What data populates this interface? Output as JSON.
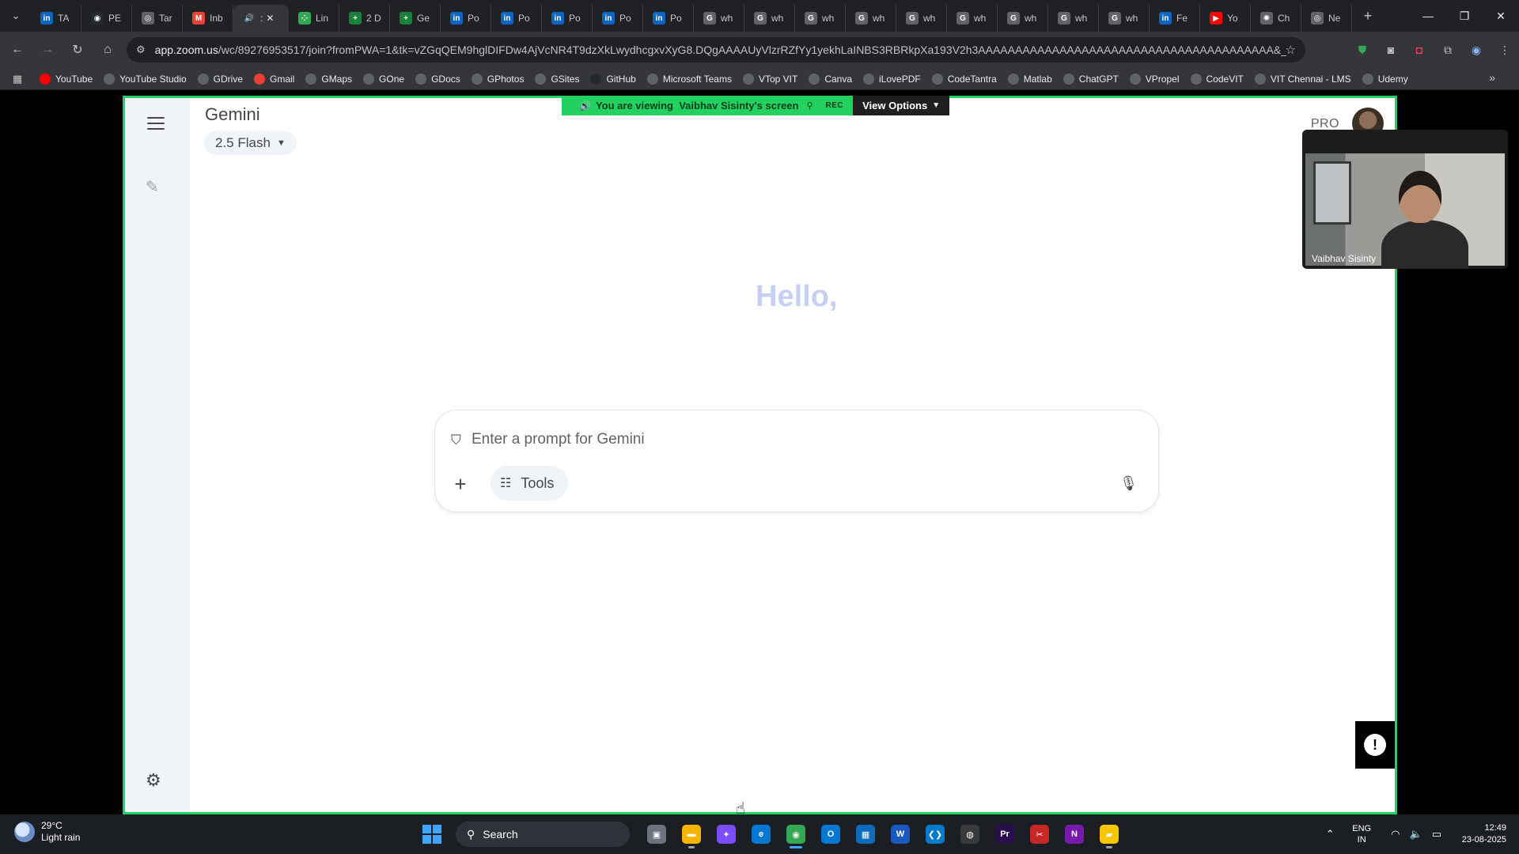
{
  "browser": {
    "tabs": [
      {
        "label": "TA",
        "icon": "linkedin-icon",
        "color": "#0a66c2",
        "glyph": "in"
      },
      {
        "label": "PE",
        "icon": "github-icon",
        "color": "#24292f",
        "glyph": "◉"
      },
      {
        "label": "Tar",
        "icon": "globe-icon",
        "color": "#5f6368",
        "glyph": "◎"
      },
      {
        "label": "Inb",
        "icon": "gmail-icon",
        "color": "#ea4335",
        "glyph": "M"
      },
      {
        "label": ":",
        "icon": "speaker-icon",
        "color": "#35363a",
        "glyph": "🔊",
        "active": true
      },
      {
        "label": "Lin",
        "icon": "dots-icon",
        "color": "#34a853",
        "glyph": "⁘"
      },
      {
        "label": "2 D",
        "icon": "sheets-icon",
        "color": "#188038",
        "glyph": "+"
      },
      {
        "label": "Ge",
        "icon": "sheets-icon",
        "color": "#188038",
        "glyph": "+"
      },
      {
        "label": "Po",
        "icon": "linkedin-icon",
        "color": "#0a66c2",
        "glyph": "in"
      },
      {
        "label": "Po",
        "icon": "linkedin-icon",
        "color": "#0a66c2",
        "glyph": "in"
      },
      {
        "label": "Po",
        "icon": "linkedin-icon",
        "color": "#0a66c2",
        "glyph": "in"
      },
      {
        "label": "Po",
        "icon": "linkedin-icon",
        "color": "#0a66c2",
        "glyph": "in"
      },
      {
        "label": "Po",
        "icon": "linkedin-icon",
        "color": "#0a66c2",
        "glyph": "in"
      },
      {
        "label": "wh",
        "icon": "google-icon",
        "color": "#5f6368",
        "glyph": "G"
      },
      {
        "label": "wh",
        "icon": "google-icon",
        "color": "#5f6368",
        "glyph": "G"
      },
      {
        "label": "wh",
        "icon": "google-icon",
        "color": "#5f6368",
        "glyph": "G"
      },
      {
        "label": "wh",
        "icon": "google-icon",
        "color": "#5f6368",
        "glyph": "G"
      },
      {
        "label": "wh",
        "icon": "google-icon",
        "color": "#5f6368",
        "glyph": "G"
      },
      {
        "label": "wh",
        "icon": "google-icon",
        "color": "#5f6368",
        "glyph": "G"
      },
      {
        "label": "wh",
        "icon": "google-icon",
        "color": "#5f6368",
        "glyph": "G"
      },
      {
        "label": "wh",
        "icon": "google-icon",
        "color": "#5f6368",
        "glyph": "G"
      },
      {
        "label": "wh",
        "icon": "google-icon",
        "color": "#5f6368",
        "glyph": "G"
      },
      {
        "label": "Fe",
        "icon": "linkedin-icon",
        "color": "#0a66c2",
        "glyph": "in"
      },
      {
        "label": "Yo",
        "icon": "youtube-icon",
        "color": "#ff0000",
        "glyph": "▶"
      },
      {
        "label": "Ch",
        "icon": "openai-icon",
        "color": "#5f6368",
        "glyph": "✺"
      },
      {
        "label": "Ne",
        "icon": "globe-icon",
        "color": "#5f6368",
        "glyph": "◎"
      }
    ],
    "url_host": "app.zoom.us",
    "url_path": "/wc/89276953517/join?fromPWA=1&tk=vZGqQEM9hglDIFDw4AjVcNR4T9dzXkLwydhcgxvXyG8.DQgAAAAUyVlzrRZfYy1yekhLaINBS3RBRkpXa193V2h3AAAAAAAAAAAAAAAAAAAAAAAAAAAAAAAAAAAAAAAA&_x_zm_r...",
    "bookmarks": [
      {
        "label": "YouTube",
        "color": "#ff0000"
      },
      {
        "label": "YouTube Studio",
        "color": "#5f6368"
      },
      {
        "label": "GDrive",
        "color": "#5f6368"
      },
      {
        "label": "Gmail",
        "color": "#ea4335"
      },
      {
        "label": "GMaps",
        "color": "#5f6368"
      },
      {
        "label": "GOne",
        "color": "#5f6368"
      },
      {
        "label": "GDocs",
        "color": "#5f6368"
      },
      {
        "label": "GPhotos",
        "color": "#5f6368"
      },
      {
        "label": "GSites",
        "color": "#5f6368"
      },
      {
        "label": "GitHub",
        "color": "#24292f"
      },
      {
        "label": "Microsoft Teams",
        "color": "#5f6368"
      },
      {
        "label": "VTop VIT",
        "color": "#5f6368"
      },
      {
        "label": "Canva",
        "color": "#5f6368"
      },
      {
        "label": "iLovePDF",
        "color": "#5f6368"
      },
      {
        "label": "CodeTantra",
        "color": "#5f6368"
      },
      {
        "label": "Matlab",
        "color": "#5f6368"
      },
      {
        "label": "ChatGPT",
        "color": "#5f6368"
      },
      {
        "label": "VPropel",
        "color": "#5f6368"
      },
      {
        "label": "CodeVIT",
        "color": "#5f6368"
      },
      {
        "label": "VIT Chennai - LMS",
        "color": "#5f6368"
      },
      {
        "label": "Udemy",
        "color": "#5f6368"
      }
    ]
  },
  "zoom": {
    "banner_prefix": "You are viewing",
    "banner_name": "Vaibhav Sisinty's screen",
    "rec_label": "REC",
    "view_options_label": "View Options",
    "participant_name": "Vaibhav Sisinty",
    "accent_color": "#23d160"
  },
  "gemini": {
    "title": "Gemini",
    "model_label": "2.5 Flash",
    "pro_badge": "PRO",
    "greeting": "Hello,",
    "prompt_placeholder": "Enter a prompt for Gemini",
    "tools_label": "Tools"
  },
  "taskbar": {
    "weather_temp": "29°C",
    "weather_desc": "Light rain",
    "search_label": "Search",
    "lang_1": "ENG",
    "lang_2": "IN",
    "time": "12:49",
    "date": "23-08-2025",
    "apps": [
      {
        "name": "task-view-icon",
        "color": "#6b7280",
        "glyph": "▣"
      },
      {
        "name": "file-explorer-icon",
        "color": "#f4b400",
        "glyph": "▬",
        "running": true
      },
      {
        "name": "copilot-icon",
        "color": "#7c4dff",
        "glyph": "✦"
      },
      {
        "name": "edge-icon",
        "color": "#0078d4",
        "glyph": "e"
      },
      {
        "name": "chrome-icon",
        "color": "#34a853",
        "glyph": "◉",
        "active": true
      },
      {
        "name": "outlook-icon",
        "color": "#0078d4",
        "glyph": "O"
      },
      {
        "name": "store-icon",
        "color": "#0f6cbd",
        "glyph": "▦"
      },
      {
        "name": "word-icon",
        "color": "#185abd",
        "glyph": "W"
      },
      {
        "name": "vscode-icon",
        "color": "#007acc",
        "glyph": "❮❯"
      },
      {
        "name": "obs-icon",
        "color": "#3a3a3a",
        "glyph": "◍"
      },
      {
        "name": "premiere-icon",
        "color": "#2a0d4d",
        "glyph": "Pr"
      },
      {
        "name": "snipping-icon",
        "color": "#c62828",
        "glyph": "✂"
      },
      {
        "name": "onenote-icon",
        "color": "#7719aa",
        "glyph": "N"
      },
      {
        "name": "sticky-notes-icon",
        "color": "#f7c600",
        "glyph": "▰",
        "running": true
      }
    ]
  }
}
